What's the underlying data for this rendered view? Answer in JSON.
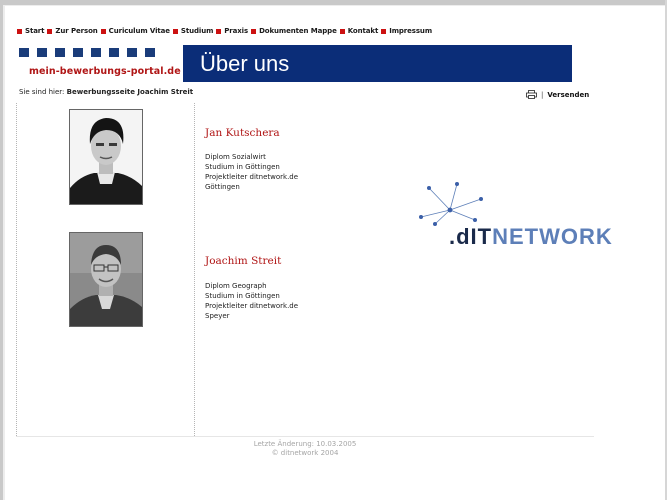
{
  "nav": {
    "items": [
      {
        "label": "Start"
      },
      {
        "label": "Zur Person"
      },
      {
        "label": "Curiculum Vitae"
      },
      {
        "label": "Studium"
      },
      {
        "label": "Praxis"
      },
      {
        "label": "Dokumenten Mappe"
      },
      {
        "label": "Kontakt"
      },
      {
        "label": "Impressum"
      }
    ],
    "bullet_color": "#cc1111"
  },
  "logo": {
    "text": "mein-bewerbungs-portal.de",
    "square_color": "#1a3c7a",
    "text_color": "#b01515"
  },
  "banner": {
    "title": "Über uns",
    "background": "#0b2d78"
  },
  "breadcrumb": {
    "prefix": "Sie sind hier:",
    "page": "Bewerbungsseite Joachim Streit"
  },
  "actions": {
    "send_label": "Versenden",
    "separator": "|"
  },
  "people": [
    {
      "name": "Jan Kutschera",
      "lines": [
        "Diplom Sozialwirt",
        "Studium in Göttingen",
        "Projektleiter ditnetwork.de",
        "Göttingen"
      ]
    },
    {
      "name": "Joachim Streit",
      "lines": [
        "Diplom Geograph",
        "Studium in Göttingen",
        "Projektleiter ditnetwork.de",
        "Speyer"
      ]
    }
  ],
  "partner_logo": {
    "part1": ".dIT",
    "part2": "NETWORK",
    "dark_color": "#1a2a4a",
    "light_color": "#5d7fb8"
  },
  "footer": {
    "last_change": "Letzte Änderung: 10.03.2005",
    "copyright": "© ditnetwork 2004"
  }
}
